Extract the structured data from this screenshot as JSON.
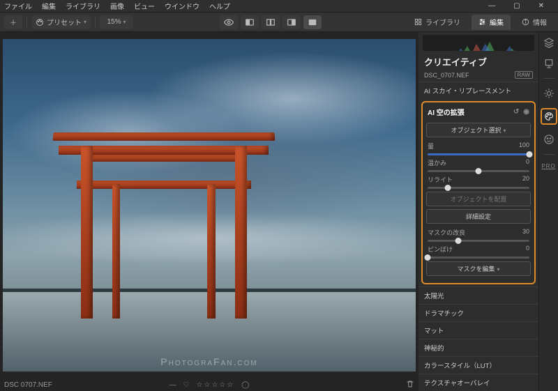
{
  "menubar": {
    "items": [
      "ファイル",
      "編集",
      "ライブラリ",
      "画像",
      "ビュー",
      "ウインドウ",
      "ヘルプ"
    ]
  },
  "toolbar": {
    "add_label": "＋",
    "preset_label": "プリセット",
    "zoom_value": "15%",
    "tabs": {
      "library": "ライブラリ",
      "edit": "編集",
      "info": "情報"
    }
  },
  "panel": {
    "title": "クリエイティブ",
    "filename": "DSC_0707.NEF",
    "raw_badge": "RAW",
    "section_sky_replace": "AI スカイ・リプレースメント",
    "highlight": {
      "title": "AI 空の拡張",
      "btn_object_select": "オブジェクト選択",
      "sliders": {
        "amount": {
          "label": "量",
          "value": 100,
          "pos": 100
        },
        "warmth": {
          "label": "温かみ",
          "value": 0,
          "pos": 50
        },
        "relight": {
          "label": "リライト",
          "value": 20,
          "pos": 20
        }
      },
      "btn_place_object": "オブジェクトを配置",
      "btn_advanced": "詳細設定",
      "sliders2": {
        "mask_blur": {
          "label": "マスクの改良",
          "value": 30,
          "pos": 30
        },
        "defocus": {
          "label": "ピンぼけ",
          "value": 0,
          "pos": 0
        }
      },
      "btn_edit_mask": "マスクを編集"
    },
    "sections_below": [
      "太陽光",
      "ドラマチック",
      "マット",
      "神秘的",
      "カラースタイル（LUT）",
      "テクスチャオーバレイ"
    ]
  },
  "toolstrip": {
    "pro_label": "PRO"
  },
  "statusbar": {
    "filename": "DSC 0707.NEF"
  },
  "watermark": "PhotograFan.com"
}
